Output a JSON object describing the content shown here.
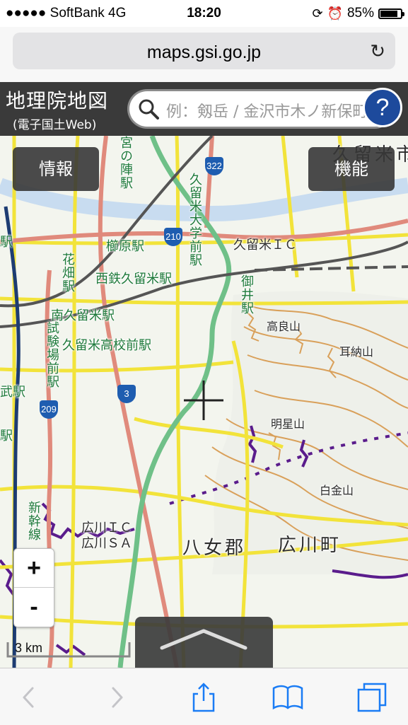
{
  "status_bar": {
    "signal_carrier": "●●●●● SoftBank  4G",
    "time": "18:20",
    "battery": "85%",
    "battery_level": 0.85
  },
  "browser": {
    "url": "maps.gsi.go.jp"
  },
  "header": {
    "title": "地理院地図",
    "subtitle": "(電子国土Web)",
    "search_placeholder": "例：剱岳 / 金沢市木ノ新保町",
    "help_label": "?"
  },
  "map_buttons": {
    "info": "情報",
    "functions": "機能"
  },
  "zoom": {
    "in": "+",
    "out": "-"
  },
  "scale": {
    "label": "3 km"
  },
  "map_labels": {
    "kurume_city": "久留米市",
    "kurume_univ_station": "久留米大学前駅",
    "kurume_ic": "久留米ＩＣ",
    "mii_station": "御井駅",
    "kushihara_station": "櫛原駅",
    "nishitetsu_kurume_station": "西鉄久留米駅",
    "hanabatake_station": "花畑駅",
    "minami_kurume_station": "南久留米駅",
    "kurume_koko_station": "久留米高校前駅",
    "shiken_jo_station": "試験場前駅",
    "jinnomae_station": "宮の陣駅",
    "koura_san": "高良山",
    "mimino_san": "耳納山",
    "myojo_san": "明星山",
    "shirogane_san": "白金山",
    "shinkansen": "新幹線",
    "hirokawa_ic": "広川ＩＣ",
    "hirokawa_sa": "広川ＳＡ",
    "yame_gun": "八女郡",
    "hirokawa_machi": "広川町",
    "edge_station_1": "駅",
    "edge_station_2": "武駅",
    "edge_station_3": "駅"
  },
  "route_shields": {
    "r322": "322",
    "r210": "210",
    "r3": "3",
    "r209": "209"
  },
  "toolbar": {
    "back": "back",
    "forward": "forward",
    "share": "share",
    "bookmarks": "bookmarks",
    "tabs": "tabs"
  },
  "colors": {
    "header_bg": "#3a3a3a",
    "help_bg": "#1d4a9c",
    "road_yellow": "#f2e33a",
    "road_red": "#e08a7c",
    "expressway": "#6fc088",
    "rail": "#555555",
    "contour": "#d9a05a",
    "boundary": "#5a1c8c",
    "river": "#c8dcf0"
  }
}
